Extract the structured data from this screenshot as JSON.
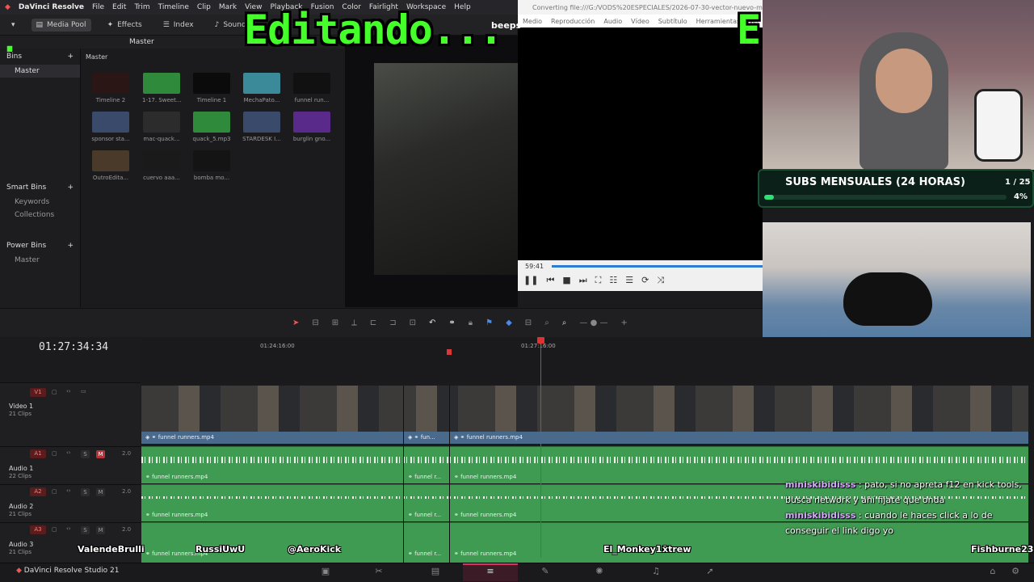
{
  "app": {
    "name": "DaVinci Resolve",
    "status_name": "DaVinci Resolve Studio 21"
  },
  "menu": [
    "File",
    "Edit",
    "Trim",
    "Timeline",
    "Clip",
    "Mark",
    "View",
    "Playback",
    "Fusion",
    "Color",
    "Fairlight",
    "Workspace",
    "Help"
  ],
  "toolbar": {
    "media_pool": "Media Pool",
    "effects": "Effects",
    "index": "Index",
    "sound_library": "Sound Lil"
  },
  "breadcrumb": {
    "top": "Master",
    "pool": "Master"
  },
  "bins": {
    "header": "Bins",
    "master": "Master",
    "smart_header": "Smart Bins",
    "smart_items": [
      "Keywords",
      "Collections"
    ],
    "power_header": "Power Bins",
    "power_items": [
      "Master"
    ]
  },
  "clips": [
    {
      "name": "Timeline 2"
    },
    {
      "name": "1-17. Sweet..."
    },
    {
      "name": "Timeline 1"
    },
    {
      "name": "MechaPato..."
    },
    {
      "name": "funnel run..."
    },
    {
      "name": "sponsor sta..."
    },
    {
      "name": "mac-quack..."
    },
    {
      "name": "quack_5.mp3"
    },
    {
      "name": "STARDESK I..."
    },
    {
      "name": "burglin gno..."
    },
    {
      "name": "OutroEdita..."
    },
    {
      "name": "cuervo aaa..."
    },
    {
      "name": "bomba mo..."
    }
  ],
  "overlay": {
    "editing": "Editando...",
    "editing_cut": "E",
    "dot": ".",
    "beeps": "beeps"
  },
  "vlc": {
    "title": "Converting file:///G:/VODS%20ESPECIALES/2026-07-30-vector-nuevo-mousepad-epic...",
    "menu": [
      "Medio",
      "Reproducción",
      "Audio",
      "Vídeo",
      "Subtítulo",
      "Herramientas",
      "Ver"
    ],
    "time": "59:41"
  },
  "subs": {
    "title": "SUBS MENSUALES (24 HORAS)",
    "count": "1 / 25",
    "percent_label": "4%",
    "progress": 0.04
  },
  "timeline": {
    "timecode": "01:27:34:34",
    "ruler": [
      "01:24:16:00",
      "01:27:16:00"
    ],
    "video": {
      "badge": "V1",
      "name": "Video 1",
      "clips": "21 Clips",
      "segments": [
        "funnel runners.mp4",
        "fun...",
        "funnel runners.mp4"
      ]
    },
    "audio": [
      {
        "badge": "A1",
        "name": "Audio 1",
        "clips": "22 Clips",
        "level": "2.0",
        "segments": [
          "funnel runners.mp4",
          "funnel r...",
          "funnel runners.mp4"
        ]
      },
      {
        "badge": "A2",
        "name": "Audio 2",
        "clips": "21 Clips",
        "level": "2.0",
        "segments": [
          "funnel runners.mp4",
          "funnel r...",
          "funnel runners.mp4"
        ]
      },
      {
        "badge": "A3",
        "name": "Audio 3",
        "clips": "21 Clips",
        "level": "2.0",
        "segments": [
          "funnel runners.mp4",
          "funnel r...",
          "funnel runners.mp4"
        ]
      }
    ]
  },
  "chat": [
    {
      "user": "miniskibidisss",
      "text": "pato, si no apreta f12 en kick tools, busca network y ahí fijate que onda"
    },
    {
      "user": "miniskibidisss",
      "text": "cuando le haces click a lo de conseguir el link digo yo"
    }
  ],
  "viewers": [
    "ValendeBrulli",
    "RussiUwU",
    "@AeroKick",
    "El_Monkey19",
    "xtrew",
    "Fishburne23"
  ],
  "colors": {
    "accent_green": "#45ff2a",
    "playhead": "#e03030",
    "audio": "#3f9a52",
    "video_label": "#4a6a8c"
  }
}
